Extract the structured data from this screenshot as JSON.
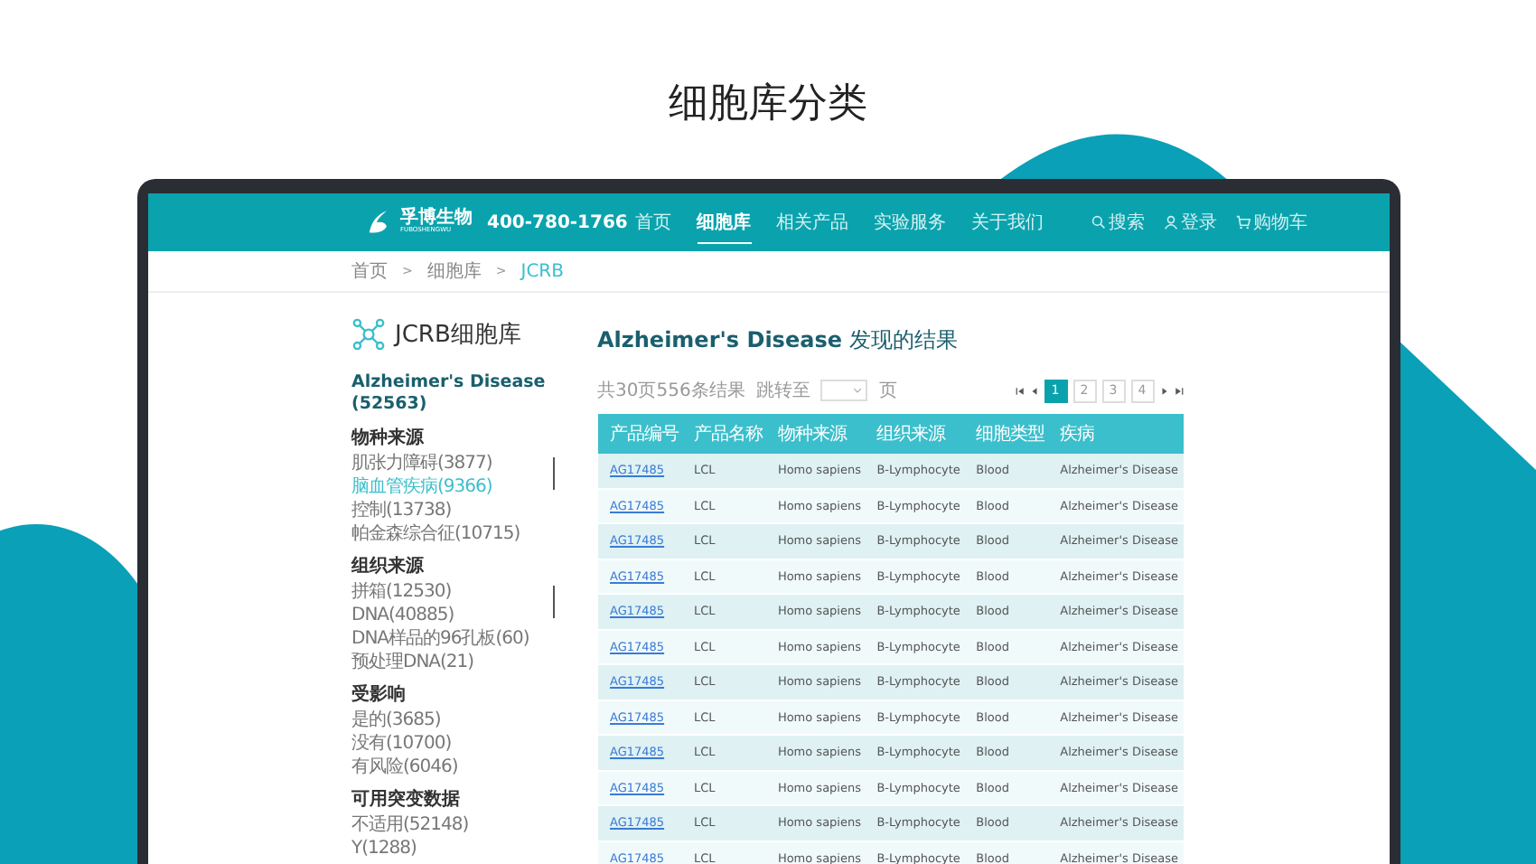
{
  "page_title": "细胞库分类",
  "header": {
    "brand": "孚博生物",
    "brand_sub": "FUBOSHENGWU",
    "phone": "400-780-1766",
    "nav": [
      {
        "label": "首页",
        "selected": false
      },
      {
        "label": "细胞库",
        "selected": true
      },
      {
        "label": "相关产品",
        "selected": false
      },
      {
        "label": "实验服务",
        "selected": false
      },
      {
        "label": "关于我们",
        "selected": false
      }
    ],
    "actions": [
      {
        "kind": "search",
        "label": "搜索"
      },
      {
        "kind": "user",
        "label": "登录"
      },
      {
        "kind": "cart",
        "label": "购物车"
      }
    ]
  },
  "breadcrumb": [
    {
      "label": "首页",
      "selected": false
    },
    {
      "label": "细胞库",
      "selected": false
    },
    {
      "label": "JCRB",
      "selected": true
    }
  ],
  "breadcrumb_separator": ">",
  "sidebar": {
    "title": "JCRB细胞库",
    "heading": "Alzheimer's Disease (52563)",
    "groups": [
      {
        "title": "物种来源",
        "scrollable": true,
        "items": [
          {
            "label": "肌张力障碍(3877)",
            "selected": false
          },
          {
            "label": "脑血管疾病(9366)",
            "selected": true
          },
          {
            "label": "控制(13738)",
            "selected": false
          },
          {
            "label": "帕金森综合征(10715)",
            "selected": false
          }
        ]
      },
      {
        "title": "组织来源",
        "scrollable": true,
        "items": [
          {
            "label": "拼箱(12530)",
            "selected": false
          },
          {
            "label": "DNA(40885)",
            "selected": false
          },
          {
            "label": "DNA样品的96孔板(60)",
            "selected": false
          },
          {
            "label": "预处理DNA(21)",
            "selected": false
          }
        ]
      },
      {
        "title": "受影响",
        "scrollable": false,
        "items": [
          {
            "label": "是的(3685)",
            "selected": false
          },
          {
            "label": "没有(10700)",
            "selected": false
          },
          {
            "label": "有风险(6046)",
            "selected": false
          }
        ]
      },
      {
        "title": "可用突变数据",
        "scrollable": false,
        "items": [
          {
            "label": "不适用(52148)",
            "selected": false
          },
          {
            "label": "Y(1288)",
            "selected": false
          }
        ]
      }
    ]
  },
  "results": {
    "title_bold": "Alzheimer's Disease",
    "title_rest": "发现的结果",
    "summary": "共30页556条结果",
    "jump_label": "跳转至",
    "jump_unit": "页",
    "pages": [
      {
        "label": "1",
        "selected": true
      },
      {
        "label": "2",
        "selected": false
      },
      {
        "label": "3",
        "selected": false
      },
      {
        "label": "4",
        "selected": false
      }
    ],
    "columns": [
      "产品编号",
      "产品名称",
      "物种来源",
      "组织来源",
      "细胞类型",
      "疾病"
    ],
    "rows": [
      [
        "AG17485",
        "LCL",
        "Homo sapiens",
        "B-Lymphocyte",
        "Blood",
        "Alzheimer's Disease"
      ],
      [
        "AG17485",
        "LCL",
        "Homo sapiens",
        "B-Lymphocyte",
        "Blood",
        "Alzheimer's Disease"
      ],
      [
        "AG17485",
        "LCL",
        "Homo sapiens",
        "B-Lymphocyte",
        "Blood",
        "Alzheimer's Disease"
      ],
      [
        "AG17485",
        "LCL",
        "Homo sapiens",
        "B-Lymphocyte",
        "Blood",
        "Alzheimer's Disease"
      ],
      [
        "AG17485",
        "LCL",
        "Homo sapiens",
        "B-Lymphocyte",
        "Blood",
        "Alzheimer's Disease"
      ],
      [
        "AG17485",
        "LCL",
        "Homo sapiens",
        "B-Lymphocyte",
        "Blood",
        "Alzheimer's Disease"
      ],
      [
        "AG17485",
        "LCL",
        "Homo sapiens",
        "B-Lymphocyte",
        "Blood",
        "Alzheimer's Disease"
      ],
      [
        "AG17485",
        "LCL",
        "Homo sapiens",
        "B-Lymphocyte",
        "Blood",
        "Alzheimer's Disease"
      ],
      [
        "AG17485",
        "LCL",
        "Homo sapiens",
        "B-Lymphocyte",
        "Blood",
        "Alzheimer's Disease"
      ],
      [
        "AG17485",
        "LCL",
        "Homo sapiens",
        "B-Lymphocyte",
        "Blood",
        "Alzheimer's Disease"
      ],
      [
        "AG17485",
        "LCL",
        "Homo sapiens",
        "B-Lymphocyte",
        "Blood",
        "Alzheimer's Disease"
      ],
      [
        "AG17485",
        "LCL",
        "Homo sapiens",
        "B-Lymphocyte",
        "Blood",
        "Alzheimer's Disease"
      ]
    ]
  }
}
